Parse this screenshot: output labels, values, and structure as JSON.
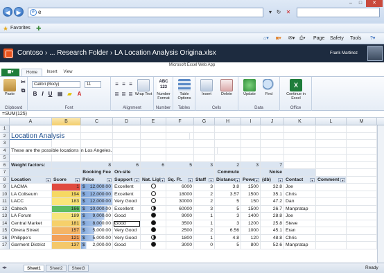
{
  "browser": {
    "address_text": "e",
    "back_icon": "back-arrow-icon",
    "forward_icon": "forward-arrow-icon",
    "favorites_label": "Favorites",
    "commands": [
      "Page",
      "Safety",
      "Tools"
    ]
  },
  "office_header": {
    "breadcrumb": "Contoso › ... Research Folder › LA Location Analysis Origina.xlsx",
    "user_name": "Frank Martinez",
    "app_title": "Microsoft Excel Web App"
  },
  "ribbon": {
    "tabs": [
      "Home",
      "Insert",
      "View"
    ],
    "active_tab": "Home",
    "font_name": "Calibri (Body)",
    "font_size": "11",
    "groups": {
      "clipboard": {
        "label": "Clipboard",
        "paste": "Paste"
      },
      "font": {
        "label": "Font"
      },
      "alignment": {
        "label": "Alignment",
        "wrap": "Wrap Text"
      },
      "number": {
        "label": "Number",
        "format": "Number Format"
      },
      "tables": {
        "label": "Tables",
        "table_options": "Table Options"
      },
      "cells": {
        "label": "Cells",
        "insert": "Insert",
        "delete": "Delete"
      },
      "data": {
        "label": "Data",
        "update": "Update",
        "find": "Find"
      },
      "office": {
        "label": "Office",
        "continue": "Continue in Excel"
      }
    }
  },
  "formula_bar": {
    "value": "=SUM(125)"
  },
  "columns": [
    "A",
    "B",
    "C",
    "D",
    "E",
    "F",
    "G",
    "H",
    "I",
    "J",
    "K",
    "L",
    "M"
  ],
  "selected_column": "B",
  "sheet": {
    "title": "Location Analysis",
    "subtitle": "These are the possible locations in Los Angeles.",
    "weight_label": "Weight factors:",
    "weights": {
      "C": "8",
      "D": "6",
      "E": "6",
      "F": "5",
      "G": "3",
      "H": "2",
      "I": "3",
      "J": "7"
    },
    "group_headers": {
      "C": "Booking Fee",
      "D": "On-site",
      "H": "Commute",
      "J": "Noise"
    },
    "headers": [
      "Location",
      "Score",
      "Price",
      "Support",
      "Nat. Light",
      "Sq. Ft.",
      "Staff",
      "Distance",
      "Power",
      "(db)",
      "Contact",
      "Comment"
    ],
    "rows": [
      {
        "num": "9",
        "loc": "LACMA",
        "score": "1",
        "price": "12,000.00",
        "support": "Excellent",
        "light": "empty",
        "sqft": "6000",
        "staff": "3",
        "dist": "3.8",
        "power": "1500",
        "db": "32.8",
        "contact": "Joe"
      },
      {
        "num": "10",
        "loc": "LA Coliseum",
        "score": "194",
        "price": "12,000.00",
        "support": "Excellent",
        "light": "empty",
        "sqft": "18000",
        "staff": "2",
        "dist": "3.57",
        "power": "1500",
        "db": "35.1",
        "contact": "Chris"
      },
      {
        "num": "11",
        "loc": "LACC",
        "score": "183",
        "price": "12,000.00",
        "support": "Very Good",
        "light": "empty",
        "sqft": "30000",
        "staff": "2",
        "dist": "5",
        "power": "150",
        "db": "47.2",
        "contact": "Dan"
      },
      {
        "num": "12",
        "loc": "Caltech",
        "score": "166",
        "price": "10,000.00",
        "support": "Excellent",
        "light": "half",
        "sqft": "60000",
        "staff": "3",
        "dist": "5",
        "power": "1500",
        "db": "26.7",
        "contact": "Manpratap"
      },
      {
        "num": "13",
        "loc": "LA Forum",
        "score": "189",
        "price": "9,000.00",
        "support": "Good",
        "light": "full",
        "sqft": "9000",
        "staff": "1",
        "dist": "3",
        "power": "1400",
        "db": "28.8",
        "contact": "Joe"
      },
      {
        "num": "14",
        "loc": "Central Market",
        "score": "181",
        "price": "8,000.00",
        "support": "Good",
        "light": "full",
        "sqft": "3500",
        "staff": "1",
        "dist": "3",
        "power": "1200",
        "db": "25.8",
        "contact": "Steve"
      },
      {
        "num": "15",
        "loc": "Olvera Street",
        "score": "157",
        "price": "5,000.00",
        "support": "Very Good",
        "light": "full",
        "sqft": "2500",
        "staff": "2",
        "dist": "6.56",
        "power": "1000",
        "db": "45.1",
        "contact": "Eran"
      },
      {
        "num": "16",
        "loc": "Philippe's",
        "score": "121",
        "price": "5,000.00",
        "support": "Very Good",
        "light": "half",
        "sqft": "1800",
        "staff": "1",
        "dist": "4.8",
        "power": "120",
        "db": "48.8",
        "contact": "Chris"
      },
      {
        "num": "17",
        "loc": "Garment District",
        "score": "137",
        "price": "2,000.00",
        "support": "Good",
        "light": "full",
        "sqft": "3000",
        "staff": "0",
        "dist": "5",
        "power": "800",
        "db": "52.6",
        "contact": "Manpratap"
      }
    ],
    "score_colors": [
      "#e04a3f",
      "#f6d862",
      "#fbe57a",
      "#5fbc63",
      "#f7e57c",
      "#f6d06a",
      "#f4b466",
      "#f2a05a",
      "#f4c86a"
    ],
    "price_fill": [
      "1.0",
      "1.0",
      "1.0",
      "0.83",
      "0.75",
      "0.67",
      "0.42",
      "0.42",
      "0.17"
    ],
    "current_cell": "D14"
  },
  "sheet_tabs": [
    "Sheet1",
    "Sheet2",
    "Sheet3"
  ],
  "active_sheet": "Sheet1",
  "status_text": "Ready"
}
